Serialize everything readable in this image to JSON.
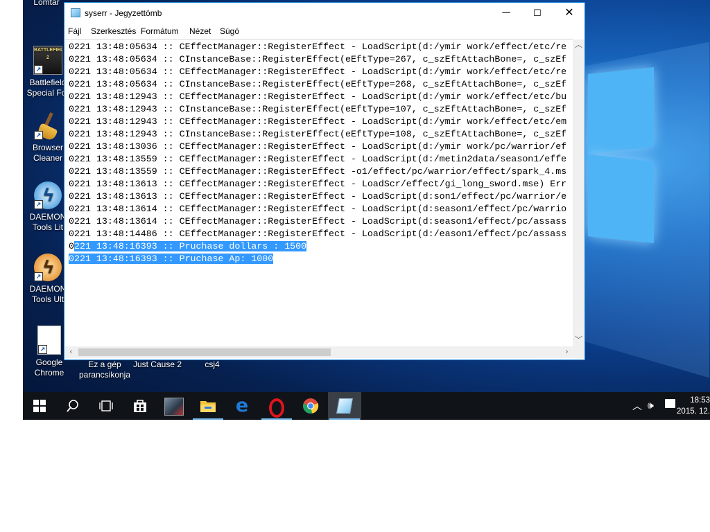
{
  "desktop": {
    "icons": [
      {
        "label": "Lomtár",
        "label2": ""
      },
      {
        "label": "Battlefield",
        "label2": "Special For"
      },
      {
        "label": "Browser",
        "label2": "Cleaner"
      },
      {
        "label": "DAEMON",
        "label2": "Tools Lit"
      },
      {
        "label": "DAEMON",
        "label2": "Tools Ult"
      },
      {
        "label": "Google",
        "label2": "Chrome"
      },
      {
        "label": "Ez a gép",
        "label2": "parancsikonja"
      },
      {
        "label": "Just Cause 2",
        "label2": ""
      },
      {
        "label": "csj4",
        "label2": ""
      }
    ],
    "battlefield_badge": "BATTLEFIELD 2"
  },
  "window": {
    "title": "syserr - Jegyzettömb",
    "minimize": "─",
    "maximize": "☐",
    "close": "✕"
  },
  "menu": [
    "Fájl",
    "Szerkesztés",
    "Formátum",
    "Nézet",
    "Súgó"
  ],
  "editor": {
    "lines": [
      "0221 13:48:05634 :: CEffectManager::RegisterEffect - LoadScript(d:/ymir work/effect/etc/re",
      "0221 13:48:05634 :: CInstanceBase::RegisterEffect(eEftType=267, c_szEftAttachBone=, c_szEf",
      "0221 13:48:05634 :: CEffectManager::RegisterEffect - LoadScript(d:/ymir work/effect/etc/re",
      "0221 13:48:05634 :: CInstanceBase::RegisterEffect(eEftType=268, c_szEftAttachBone=, c_szEf",
      "0221 13:48:12943 :: CEffectManager::RegisterEffect - LoadScript(d:/ymir work/effect/etc/bu",
      "0221 13:48:12943 :: CInstanceBase::RegisterEffect(eEftType=107, c_szEftAttachBone=, c_szEf",
      "0221 13:48:12943 :: CEffectManager::RegisterEffect - LoadScript(d:/ymir work/effect/etc/em",
      "0221 13:48:12943 :: CInstanceBase::RegisterEffect(eEftType=108, c_szEftAttachBone=, c_szEf",
      "0221 13:48:13036 :: CEffectManager::RegisterEffect - LoadScript(d:/ymir work/pc/warrior/ef",
      "0221 13:48:13559 :: CEffectManager::RegisterEffect - LoadScript(d:/metin2data/season1/effe",
      "0221 13:48:13559 :: CEffectManager::RegisterEffect -o1/effect/pc/warrior/effect/spark_4.ms",
      "0221 13:48:13613 :: CEffectManager::RegisterEffect - LoadScr/effect/gi_long_sword.mse) Err",
      "0221 13:48:13613 :: CEffectManager::RegisterEffect - LoadScript(d:son1/effect/pc/warrior/e",
      "0221 13:48:13614 :: CEffectManager::RegisterEffect - LoadScript(d:season1/effect/pc/warrio",
      "0221 13:48:13614 :: CEffectManager::RegisterEffect - LoadScript(d:season1/effect/pc/assass",
      "0221 13:48:14486 :: CEffectManager::RegisterEffect - LoadScript(d:/eason1/effect/pc/assass"
    ],
    "selected_line1_prefix": "0",
    "selected_line1_rest": "221 13:48:16393 :: Pruchase dollars : 1500",
    "selected_line2": "0221 13:48:16393 :: Pruchase Ap: 1000",
    "horizontal_scroll_fraction": 0.0
  },
  "taskbar": {
    "items": [
      "start",
      "search",
      "task-view",
      "store",
      "metin2",
      "file-explorer",
      "edge",
      "opera",
      "chrome",
      "notepad"
    ],
    "clock_time": "18:53",
    "clock_date": "2015. 12."
  },
  "colors": {
    "selection": "#3399ff",
    "window_border": "#1883d7",
    "taskbar": "#101418",
    "indicator": "#76b9ed"
  }
}
